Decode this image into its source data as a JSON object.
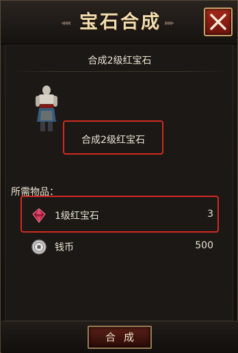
{
  "window": {
    "title": "宝石合成",
    "close_icon": "close-x-icon"
  },
  "main": {
    "subtitle": "合成2级红宝石",
    "target_label": "合成2级红宝石",
    "requirements_header": "所需物品：",
    "requirements": [
      {
        "icon": "red-gem-icon",
        "name": "1级红宝石",
        "quantity": "3"
      },
      {
        "icon": "coin-icon",
        "name": "钱币",
        "quantity": "500"
      }
    ]
  },
  "footer": {
    "merge_button": "合成"
  },
  "colors": {
    "highlight_border": "#d32a22",
    "close_button": "#8e2218",
    "title_text": "#f2ddb0"
  }
}
